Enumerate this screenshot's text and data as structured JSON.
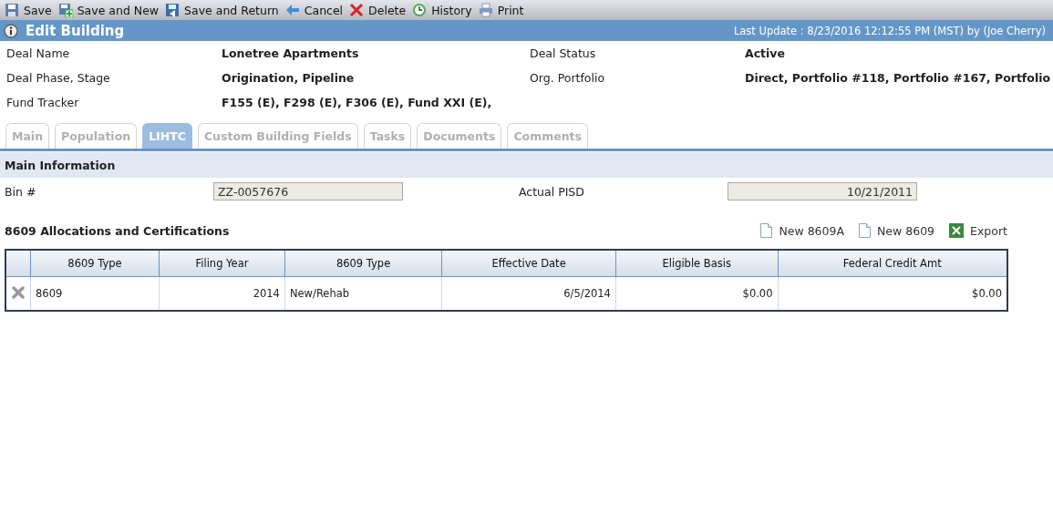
{
  "toolbar": [
    {
      "kind": "save",
      "label": "Save"
    },
    {
      "kind": "save-new",
      "label": "Save and New"
    },
    {
      "kind": "save-return",
      "label": "Save and Return"
    },
    {
      "kind": "cancel",
      "label": "Cancel"
    },
    {
      "kind": "delete",
      "label": "Delete"
    },
    {
      "kind": "history",
      "label": "History"
    },
    {
      "kind": "print",
      "label": "Print"
    }
  ],
  "header": {
    "title": "Edit Building",
    "last_update": "Last Update : 8/23/2016 12:12:55 PM (MST) by (Joe Cherry)"
  },
  "fields": [
    {
      "label": "Deal Name",
      "value": "Lonetree Apartments"
    },
    {
      "label": "Deal Status",
      "value": "Active"
    },
    {
      "label": "Deal Phase, Stage",
      "value": "Origination, Pipeline"
    },
    {
      "label": "Org. Portfolio",
      "value": "Direct, Portfolio #118, Portfolio #167, Portfolio"
    },
    {
      "label": "Fund Tracker",
      "value": "F155 (E), F298 (E), F306 (E), Fund XXI (E),"
    }
  ],
  "tabs": [
    {
      "label": "Main",
      "selected": false
    },
    {
      "label": "Population",
      "selected": false
    },
    {
      "label": "LIHTC",
      "selected": true
    },
    {
      "label": "Custom Building Fields",
      "selected": false
    },
    {
      "label": "Tasks",
      "selected": false
    },
    {
      "label": "Documents",
      "selected": false
    },
    {
      "label": "Comments",
      "selected": false
    }
  ],
  "main_information": {
    "title": "Main Information",
    "bin_label": "Bin #",
    "bin_value": "ZZ-0057676",
    "pisd_label": "Actual PISD",
    "pisd_value": "10/21/2011"
  },
  "allocations": {
    "title": "8609 Allocations and Certifications",
    "actions": [
      {
        "kind": "document",
        "label": "New 8609A"
      },
      {
        "kind": "document",
        "label": "New 8609"
      },
      {
        "kind": "excel",
        "label": "Export"
      }
    ],
    "table": {
      "columns": [
        {
          "label": "8609 Type",
          "right_aligned": false
        },
        {
          "label": "Filing Year",
          "right_aligned": true
        },
        {
          "label": "8609 Type",
          "right_aligned": false
        },
        {
          "label": "Effective Date",
          "right_aligned": true
        },
        {
          "label": "Eligible Basis",
          "right_aligned": true
        },
        {
          "label": "Federal Credit Amt",
          "right_aligned": true
        }
      ],
      "rows": [
        [
          "8609",
          "2014",
          "New/Rehab",
          "6/5/2014",
          "$0.00",
          "$0.00"
        ]
      ]
    }
  }
}
